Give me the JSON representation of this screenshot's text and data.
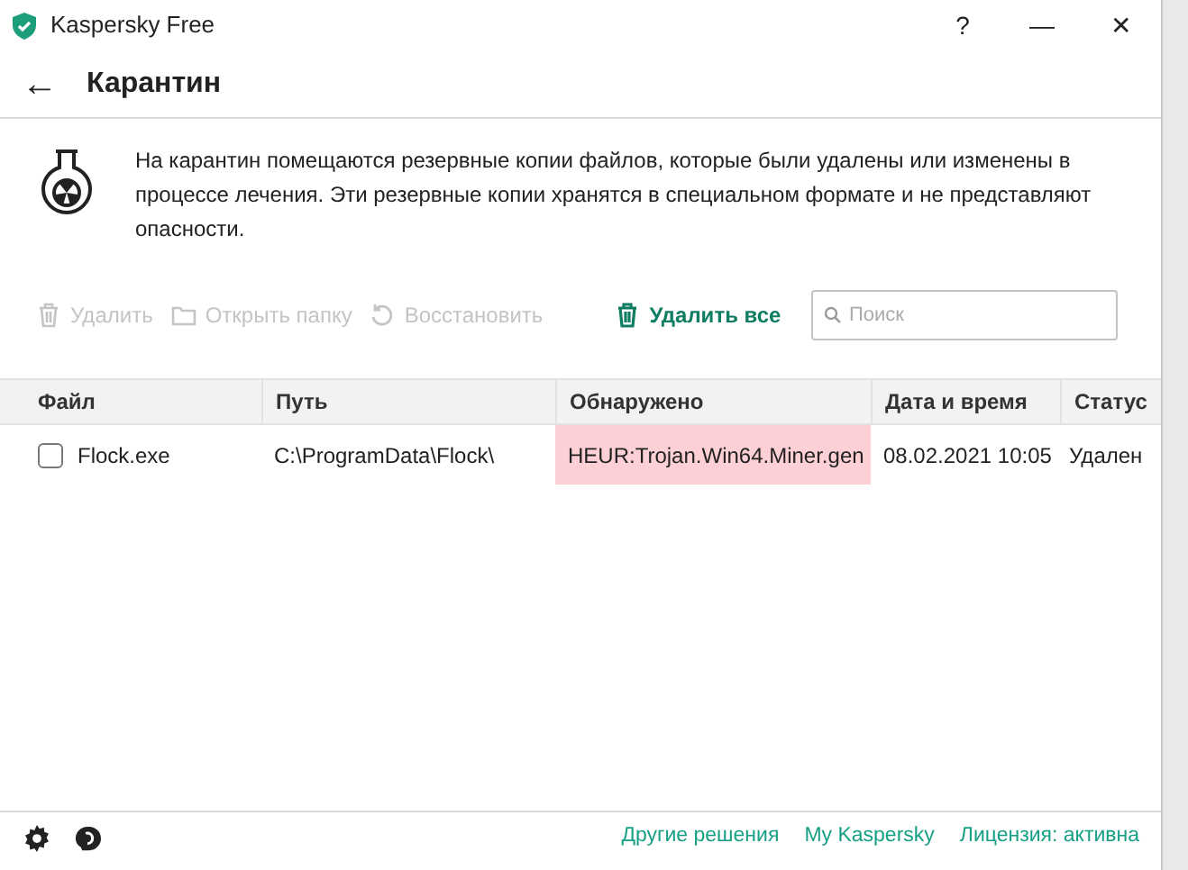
{
  "window": {
    "title": "Kaspersky Free",
    "controls": [
      "?",
      "—",
      "✕"
    ]
  },
  "header": {
    "back": "←",
    "title": "Карантин"
  },
  "info": {
    "text": "На карантин помещаются резервные копии файлов, которые были удалены или изменены в процессе лечения. Эти резервные копии хранятся в специальном формате и не представляют опасности."
  },
  "toolbar": {
    "buttons": [
      {
        "kind": "delete",
        "label": "Удалить",
        "disabled": true
      },
      {
        "kind": "folder",
        "label": "Открыть папку",
        "disabled": true
      },
      {
        "kind": "restore",
        "label": "Восстановить",
        "disabled": true
      },
      {
        "kind": "delete-all",
        "label": "Удалить все",
        "disabled": false
      }
    ],
    "search": {
      "placeholder": "Поиск"
    }
  },
  "table": {
    "columns": [
      "Файл",
      "Путь",
      "Обнаружено",
      "Дата и время",
      "Статус"
    ],
    "rows": [
      {
        "checked": false,
        "file": "Flock.exe",
        "path": "C:\\ProgramData\\Flock\\",
        "detected": "HEUR:Trojan.Win64.Miner.gen",
        "threat": true,
        "date": "08.02.2021 10:05",
        "status": "Удален"
      }
    ]
  },
  "footer": {
    "links": [
      "Другие решения",
      "My Kaspersky",
      "Лицензия: активна"
    ]
  }
}
